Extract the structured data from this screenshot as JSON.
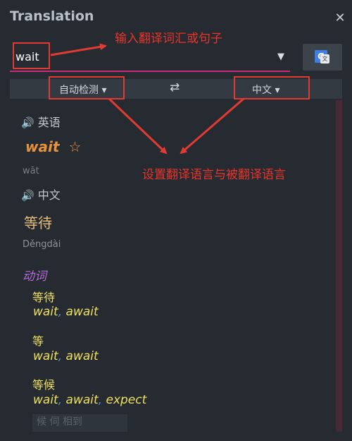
{
  "window": {
    "title": "Translation",
    "close_glyph": "✕"
  },
  "input": {
    "value": "wait",
    "dropdown_glyph": "▼"
  },
  "google_button": {
    "icon": "google-translate-icon",
    "letter": "G",
    "sub": "文"
  },
  "language_bar": {
    "source_label": "自动检测",
    "target_label": "中文",
    "dropdown_glyph": "▾",
    "swap_glyph": "⇄"
  },
  "result": {
    "source_lang": {
      "speaker_glyph": "🔊",
      "label": "英语"
    },
    "source_word": "wait",
    "star_glyph": "☆",
    "source_phonetic": "wāt",
    "target_lang": {
      "speaker_glyph": "🔊",
      "label": "中文"
    },
    "target_word": "等待",
    "target_pinyin": "Děngdài",
    "part_of_speech": "动词",
    "senses": [
      {
        "word": "等待",
        "synonyms": [
          "wait",
          "await"
        ]
      },
      {
        "word": "等",
        "synonyms": [
          "wait",
          "await"
        ]
      },
      {
        "word": "等候",
        "synonyms": [
          "wait",
          "await",
          "expect"
        ]
      }
    ],
    "faded_row": "候  伺  相到"
  },
  "annotations": {
    "input_hint": "输入翻译词汇或句子",
    "language_hint": "设置翻译语言与被翻译语言"
  },
  "colors": {
    "annotation_red": "#e03a32",
    "input_underline": "#c62a7c",
    "source_word": "#e8923a",
    "target_word": "#e7c07a",
    "part_of_speech": "#b46ad8",
    "sense": "#f0e060",
    "comma": "#4b8fd6"
  }
}
